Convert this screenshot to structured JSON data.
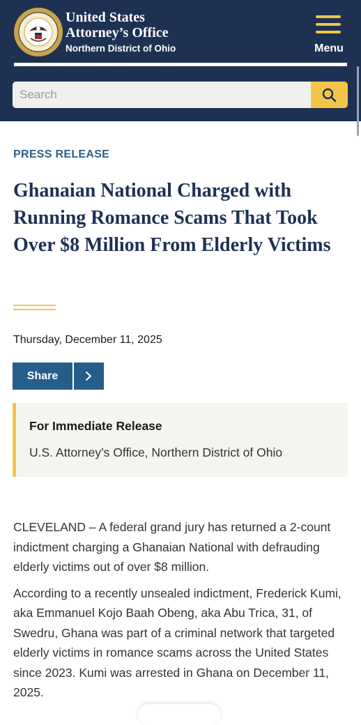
{
  "header": {
    "brand_line1": "United States",
    "brand_line2": "Attorney’s Office",
    "brand_line3": "Northern District of Ohio",
    "menu_label": "Menu",
    "colors": {
      "navy": "#1e3153",
      "gold": "#f1c54a",
      "accent_blue": "#275d8b"
    }
  },
  "search": {
    "placeholder": "Search",
    "button_icon": "search-icon"
  },
  "article": {
    "eyebrow": "PRESS RELEASE",
    "title": "Ghanaian National Charged with Running Romance Scams That Took Over $8 Million From Elderly Victims",
    "date": "Thursday, December 11, 2025",
    "share_label": "Share",
    "notice_heading": "For Immediate Release",
    "notice_body": "U.S. Attorney’s Office, Northern District of Ohio",
    "paragraphs": [
      "CLEVELAND – A federal grand jury has returned a 2-count indictment charging a Ghanaian National with defrauding elderly victims out of over $8 million.",
      "According to a recently unsealed indictment, Frederick Kumi, aka Emmanuel Kojo Baah Obeng, aka Abu Trica, 31, of Swedru, Ghana was part of a criminal network that targeted elderly victims in romance scams across the United States since 2023.  Kumi was arrested in Ghana on December 11, 2025."
    ]
  }
}
